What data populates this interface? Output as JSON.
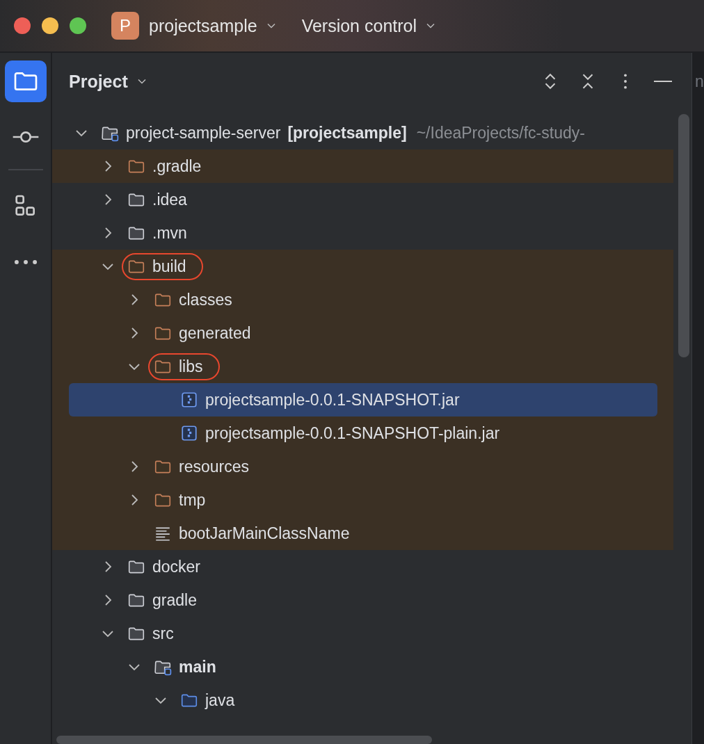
{
  "title_bar": {
    "project": {
      "initial": "P",
      "name": "projectsample"
    },
    "vcs_menu": "Version control"
  },
  "tool_strip": [
    {
      "kind": "project",
      "selected": true
    },
    {
      "kind": "commit",
      "selected": false
    },
    {
      "kind": "structure",
      "selected": false
    },
    {
      "kind": "more",
      "selected": false
    }
  ],
  "panel": {
    "title": "Project"
  },
  "editor_tab_fragment": "n",
  "tree": [
    {
      "kind": "module-folder",
      "name": "project-sample-server",
      "module": "[projectsample]",
      "path": "~/IdeaProjects/fc-study-",
      "expanded": true,
      "selected": false,
      "excluded": false,
      "children": [
        {
          "kind": "excluded-folder",
          "name": ".gradle",
          "expanded": false,
          "selected": false,
          "excluded": true
        },
        {
          "kind": "folder",
          "name": ".idea",
          "expanded": false,
          "selected": false,
          "excluded": false
        },
        {
          "kind": "folder",
          "name": ".mvn",
          "expanded": false,
          "selected": false,
          "excluded": false
        },
        {
          "kind": "excluded-folder",
          "name": "build",
          "expanded": true,
          "selected": false,
          "excluded": true,
          "circled": true,
          "children": [
            {
              "kind": "excluded-folder",
              "name": "classes",
              "expanded": false,
              "selected": false,
              "excluded": true
            },
            {
              "kind": "excluded-folder",
              "name": "generated",
              "expanded": false,
              "selected": false,
              "excluded": true
            },
            {
              "kind": "excluded-folder",
              "name": "libs",
              "expanded": true,
              "selected": false,
              "excluded": true,
              "circled": true,
              "children": [
                {
                  "kind": "jar",
                  "name": "projectsample-0.0.1-SNAPSHOT.jar",
                  "selected": true,
                  "excluded": true
                },
                {
                  "kind": "jar",
                  "name": "projectsample-0.0.1-SNAPSHOT-plain.jar",
                  "selected": false,
                  "excluded": true
                }
              ]
            },
            {
              "kind": "excluded-folder",
              "name": "resources",
              "expanded": false,
              "selected": false,
              "excluded": true
            },
            {
              "kind": "excluded-folder",
              "name": "tmp",
              "expanded": false,
              "selected": false,
              "excluded": true
            },
            {
              "kind": "text-file",
              "name": "bootJarMainClassName",
              "selected": false,
              "excluded": true
            }
          ]
        },
        {
          "kind": "folder",
          "name": "docker",
          "expanded": false,
          "selected": false,
          "excluded": false
        },
        {
          "kind": "folder",
          "name": "gradle",
          "expanded": false,
          "selected": false,
          "excluded": false
        },
        {
          "kind": "folder",
          "name": "src",
          "expanded": true,
          "selected": false,
          "excluded": false,
          "children": [
            {
              "kind": "module-folder",
              "name": "main",
              "bold": true,
              "expanded": true,
              "selected": false,
              "excluded": false,
              "children": [
                {
                  "kind": "source-folder",
                  "name": "java",
                  "expanded": true,
                  "selected": false,
                  "excluded": false
                }
              ]
            }
          ]
        }
      ]
    }
  ]
}
